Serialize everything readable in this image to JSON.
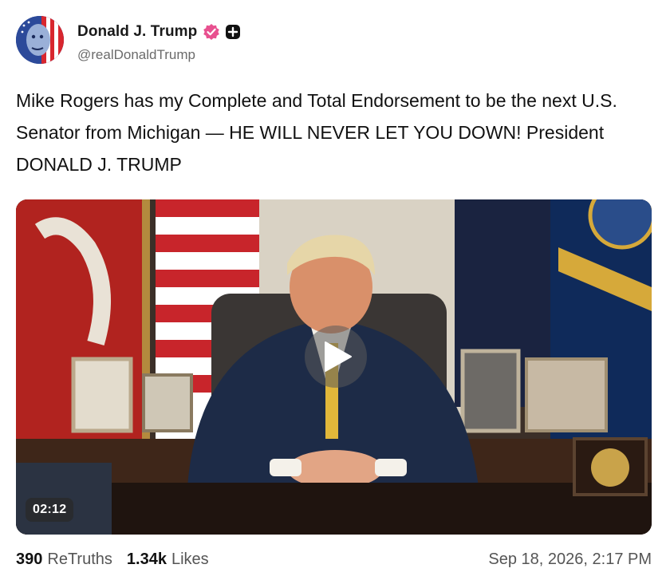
{
  "post": {
    "author": {
      "display_name": "Donald J. Trump",
      "handle": "@realDonaldTrump",
      "verified_icon": "verified-badge-icon",
      "verified_color": "#e8508f"
    },
    "text": "Mike Rogers has my Complete and Total Endorsement to be the next U.S. Senator from Michigan — HE WILL NEVER LET YOU DOWN! President DONALD J. TRUMP",
    "media": {
      "type": "video",
      "duration": "02:12",
      "play_icon": "play-icon"
    },
    "stats": {
      "retruths_count": "390",
      "retruths_label": "ReTruths",
      "likes_count": "1.34k",
      "likes_label": "Likes"
    },
    "timestamp": "Sep 18, 2026, 2:17 PM"
  }
}
